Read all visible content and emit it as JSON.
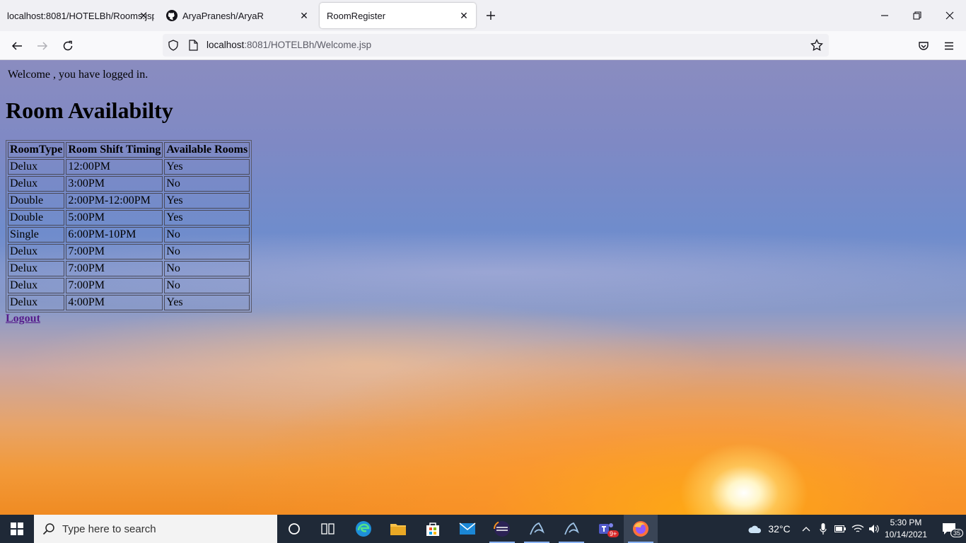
{
  "browser": {
    "tabs": [
      {
        "label": "localhost:8081/HOTELBh/Rooms.jsp"
      },
      {
        "label": "AryaPranesh/AryaR"
      },
      {
        "label": "RoomRegister"
      }
    ],
    "url_host": "localhost",
    "url_rest": ":8081/HOTELBh/Welcome.jsp"
  },
  "page": {
    "welcome_text": "Welcome , you have logged in.",
    "title": "Room Availabilty",
    "table": {
      "headers": [
        "RoomType",
        "Room Shift Timing",
        "Available Rooms"
      ],
      "rows": [
        [
          "Delux",
          "12:00PM",
          "Yes"
        ],
        [
          "Delux",
          "3:00PM",
          "No"
        ],
        [
          "Double",
          "2:00PM-12:00PM",
          "Yes"
        ],
        [
          "Double",
          "5:00PM",
          "Yes"
        ],
        [
          "Single",
          "6:00PM-10PM",
          "No"
        ],
        [
          "Delux",
          "7:00PM",
          "No"
        ],
        [
          "Delux",
          "7:00PM",
          "No"
        ],
        [
          "Delux",
          "7:00PM",
          "No"
        ],
        [
          "Delux",
          "4:00PM",
          "Yes"
        ]
      ]
    },
    "logout_label": "Logout"
  },
  "taskbar": {
    "search_placeholder": "Type here to search",
    "apps": [
      "cortana-icon",
      "task-view-icon",
      "edge-icon",
      "file-explorer-icon",
      "store-icon",
      "mail-icon",
      "eclipse-icon",
      "mysql-icon",
      "mysql-icon",
      "teams-icon",
      "firefox-icon"
    ],
    "teams_badge": "9+",
    "weather": "32°C",
    "time": "5:30 PM",
    "date": "10/14/2021",
    "notification_count": "35"
  },
  "colors": {
    "accent": "#0060df",
    "taskbar": "#1f2937",
    "link_visited": "#551a8b"
  }
}
